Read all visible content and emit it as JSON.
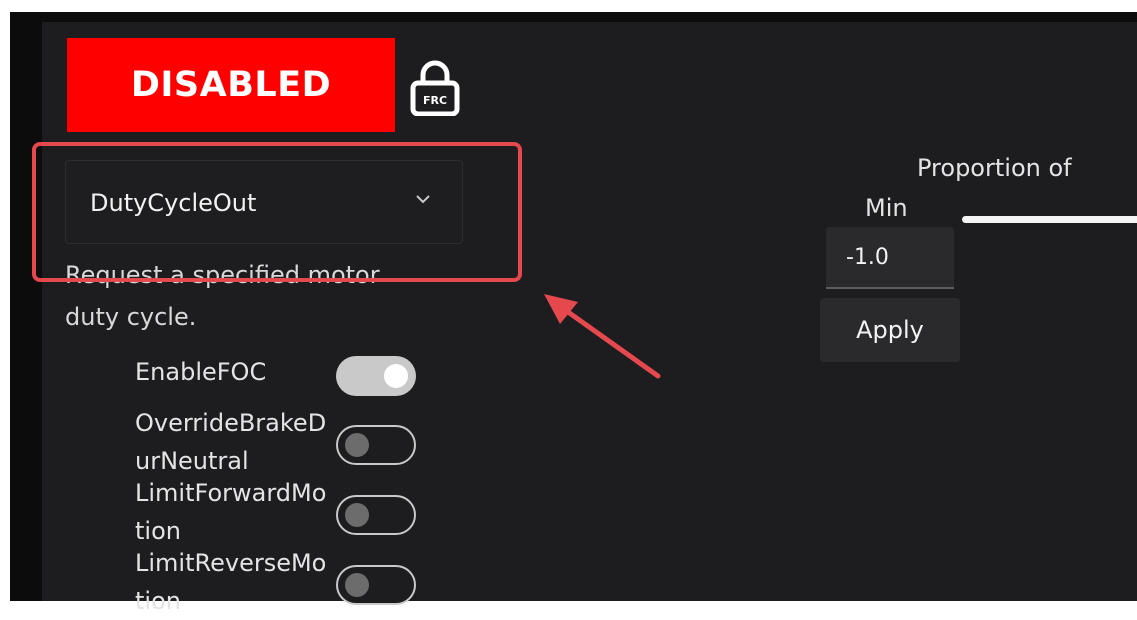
{
  "status": {
    "enabled_label": "DISABLED",
    "lock_icon": "lock-frc-icon",
    "lock_badge": "FRC",
    "color": "#ff0000"
  },
  "control_mode": {
    "selected": "DutyCycleOut",
    "description": "Request a specified motor duty cycle."
  },
  "toggles": [
    {
      "label": "EnableFOC",
      "on": true
    },
    {
      "label": "OverrideBrakeDurNeutral",
      "on": false
    },
    {
      "label": "LimitForwardMotion",
      "on": false
    },
    {
      "label": "LimitReverseMotion",
      "on": false
    }
  ],
  "slider": {
    "title": "Proportion of",
    "min_label": "Min",
    "min_value": "-1.0",
    "apply_label": "Apply"
  },
  "annotation": {
    "color": "#e5484d"
  }
}
